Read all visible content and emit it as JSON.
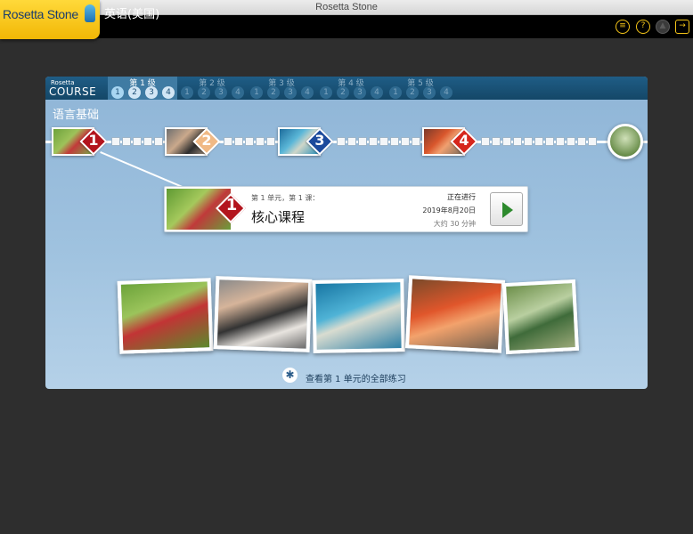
{
  "window": {
    "title": "Rosetta Stone"
  },
  "app": {
    "logo_text": "Rosetta Stone",
    "language": "英语(美国)"
  },
  "toolbar": {
    "menu_icon": "list-icon",
    "help_icon": "help-icon",
    "disabled_icon": "dim-icon",
    "exit_icon": "exit-icon"
  },
  "course": {
    "logo_top": "Rosetta",
    "logo_main": "COURSE",
    "levels": [
      {
        "label": "第 1 级",
        "units": [
          "1",
          "2",
          "3",
          "4"
        ]
      },
      {
        "label": "第 2 级",
        "units": [
          "1",
          "2",
          "3",
          "4"
        ]
      },
      {
        "label": "第 3 级",
        "units": [
          "1",
          "2",
          "3",
          "4"
        ]
      },
      {
        "label": "第 4 级",
        "units": [
          "1",
          "2",
          "3",
          "4"
        ]
      },
      {
        "label": "第 5 级",
        "units": [
          "1",
          "2",
          "3",
          "4"
        ]
      }
    ]
  },
  "section_title": "语言基础",
  "units": [
    {
      "number": "1",
      "color": "#b3141d"
    },
    {
      "number": "2",
      "color": "#f0b985"
    },
    {
      "number": "3",
      "color": "#1c4a9c"
    },
    {
      "number": "4",
      "color": "#d6261c"
    }
  ],
  "lesson_card": {
    "subtitle": "第 1 单元，第 1 课：",
    "title": "核心课程",
    "number": "1",
    "status": "正在进行",
    "date": "2019年8月20日",
    "duration": "大约 30 分钟"
  },
  "view_all": "查看第 1 单元的全部练习"
}
